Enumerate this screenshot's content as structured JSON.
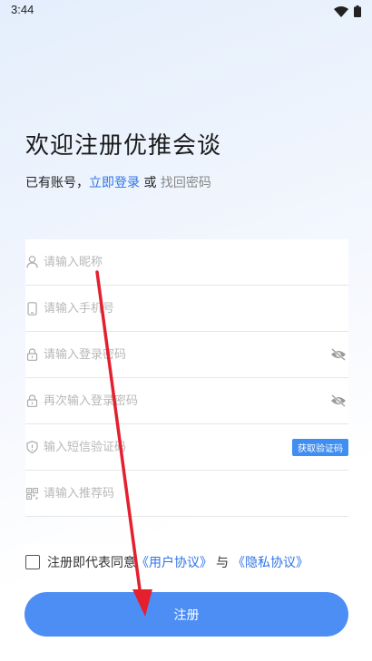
{
  "status_bar": {
    "time": "3:44"
  },
  "header": {
    "title": "欢迎注册优推会谈",
    "prefix": "已有账号，",
    "login_link": "立即登录",
    "or": " 或 ",
    "find_password": "找回密码"
  },
  "form": {
    "nickname_placeholder": "请输入昵称",
    "phone_placeholder": "请输入手机号",
    "password_placeholder": "请输入登录密码",
    "password_confirm_placeholder": "再次输入登录密码",
    "sms_placeholder": "输入短信验证码",
    "get_code_label": "获取验证码",
    "referral_placeholder": "请输入推荐码"
  },
  "agreement": {
    "prefix": "注册即代表同意",
    "user_agreement": "《用户协议》",
    "and": "与",
    "privacy_agreement": "《隐私协议》"
  },
  "submit": {
    "label": "注册"
  },
  "colors": {
    "accent": "#2f74e8",
    "button": "#4d8ef5",
    "code_button": "#3f8ef2",
    "annotation_arrow": "#e5202e"
  }
}
